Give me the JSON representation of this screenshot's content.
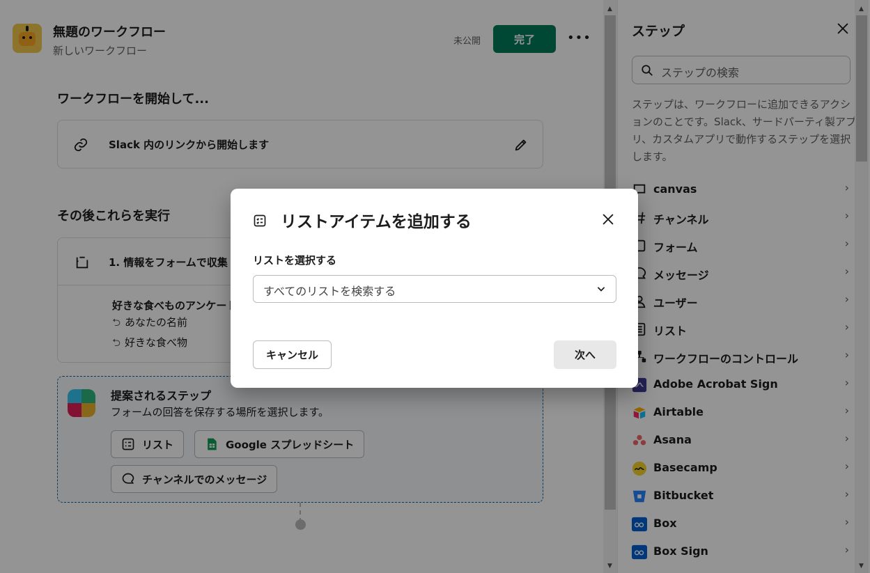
{
  "workflow": {
    "title": "無題のワークフロー",
    "subtitle": "新しいワークフロー",
    "status": "未公開",
    "done_label": "完了",
    "more_label": "•••"
  },
  "start_section": {
    "title": "ワークフローを開始して...",
    "trigger_label": "Slack 内のリンクから開始します"
  },
  "then_section": {
    "title": "その後これらを実行",
    "step1_label": "1. 情報をフォームで収集",
    "form_title": "好きな食べものアンケート",
    "fields": [
      "あなたの名前",
      "好きな食べ物"
    ]
  },
  "suggested": {
    "title": "提案されるステップ",
    "description": "フォームの回答を保存する場所を選択します。",
    "actions": [
      "リスト",
      "Google スプレッドシート",
      "チャンネルでのメッセージ"
    ]
  },
  "panel": {
    "title": "ステップ",
    "search_placeholder": "ステップの検索",
    "description": "ステップは、ワークフローに追加できるアクションのことです。Slack、サードパーティ製アプリ、カスタムアプリで動作するステップを選択します。",
    "items": [
      {
        "label": "canvas",
        "icon": "canvas-icon"
      },
      {
        "label": "チャンネル",
        "icon": "hash-icon"
      },
      {
        "label": "フォーム",
        "icon": "form-icon"
      },
      {
        "label": "メッセージ",
        "icon": "message-icon"
      },
      {
        "label": "ユーザー",
        "icon": "user-icon"
      },
      {
        "label": "リスト",
        "icon": "list-icon"
      },
      {
        "label": "ワークフローのコントロール",
        "icon": "workflow-control-icon"
      },
      {
        "label": "Adobe Acrobat Sign",
        "icon": "adobe-acrobat-sign-icon"
      },
      {
        "label": "Airtable",
        "icon": "airtable-icon"
      },
      {
        "label": "Asana",
        "icon": "asana-icon"
      },
      {
        "label": "Basecamp",
        "icon": "basecamp-icon"
      },
      {
        "label": "Bitbucket",
        "icon": "bitbucket-icon"
      },
      {
        "label": "Box",
        "icon": "box-icon"
      },
      {
        "label": "Box Sign",
        "icon": "box-sign-icon"
      }
    ]
  },
  "modal": {
    "title": "リストアイテムを追加する",
    "field_label": "リストを選択する",
    "select_value": "すべてのリストを検索する",
    "cancel_label": "キャンセル",
    "next_label": "次へ"
  },
  "colors": {
    "primary": "#007a5a",
    "suggest_border": "#1264a3",
    "overlay": "rgba(0,0,0,0.42)"
  }
}
